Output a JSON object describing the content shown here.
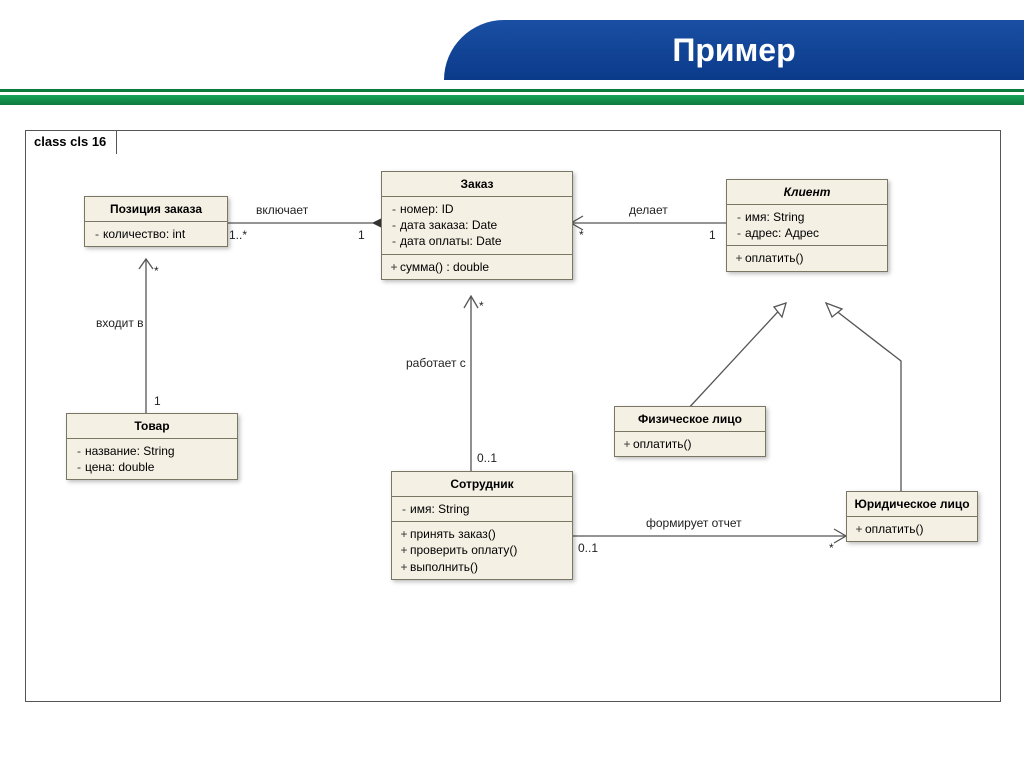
{
  "slide": {
    "title": "Пример"
  },
  "frame": {
    "label": "class cls 16"
  },
  "classes": {
    "order_item": {
      "name": "Позиция заказа",
      "attrs": [
        {
          "vis": "-",
          "text": "количество: int"
        }
      ]
    },
    "order": {
      "name": "Заказ",
      "attrs": [
        {
          "vis": "-",
          "text": "номер: ID"
        },
        {
          "vis": "-",
          "text": "дата заказа: Date"
        },
        {
          "vis": "-",
          "text": "дата оплаты: Date"
        }
      ],
      "ops": [
        {
          "vis": "+",
          "text": "сумма() : double"
        }
      ]
    },
    "client": {
      "name": "Клиент",
      "attrs": [
        {
          "vis": "-",
          "text": "имя: String"
        },
        {
          "vis": "-",
          "text": "адрес: Адрес"
        }
      ],
      "ops": [
        {
          "vis": "+",
          "text": "оплатить()"
        }
      ]
    },
    "product": {
      "name": "Товар",
      "attrs": [
        {
          "vis": "-",
          "text": "название: String"
        },
        {
          "vis": "-",
          "text": "цена: double"
        }
      ]
    },
    "employee": {
      "name": "Сотрудник",
      "attrs": [
        {
          "vis": "-",
          "text": "имя: String"
        }
      ],
      "ops": [
        {
          "vis": "+",
          "text": "принять заказ()"
        },
        {
          "vis": "+",
          "text": "проверить оплату()"
        },
        {
          "vis": "+",
          "text": "выполнить()"
        }
      ]
    },
    "person": {
      "name": "Физическое лицо",
      "ops": [
        {
          "vis": "+",
          "text": "оплатить()"
        }
      ]
    },
    "company": {
      "name": "Юридическое лицо",
      "ops": [
        {
          "vis": "+",
          "text": "оплатить()"
        }
      ]
    }
  },
  "relations": {
    "includes": {
      "label": "включает",
      "m_left": "1..*",
      "m_right": "1"
    },
    "makes": {
      "label": "делает",
      "m_left": "*",
      "m_right": "1"
    },
    "partof": {
      "label": "входит в",
      "m_top": "*",
      "m_bottom": "1"
    },
    "workswith": {
      "label": "работает с",
      "m_top": "*",
      "m_bottom": "0..1"
    },
    "reports": {
      "label": "формирует отчет",
      "m_left": "0..1",
      "m_right": "*"
    }
  }
}
